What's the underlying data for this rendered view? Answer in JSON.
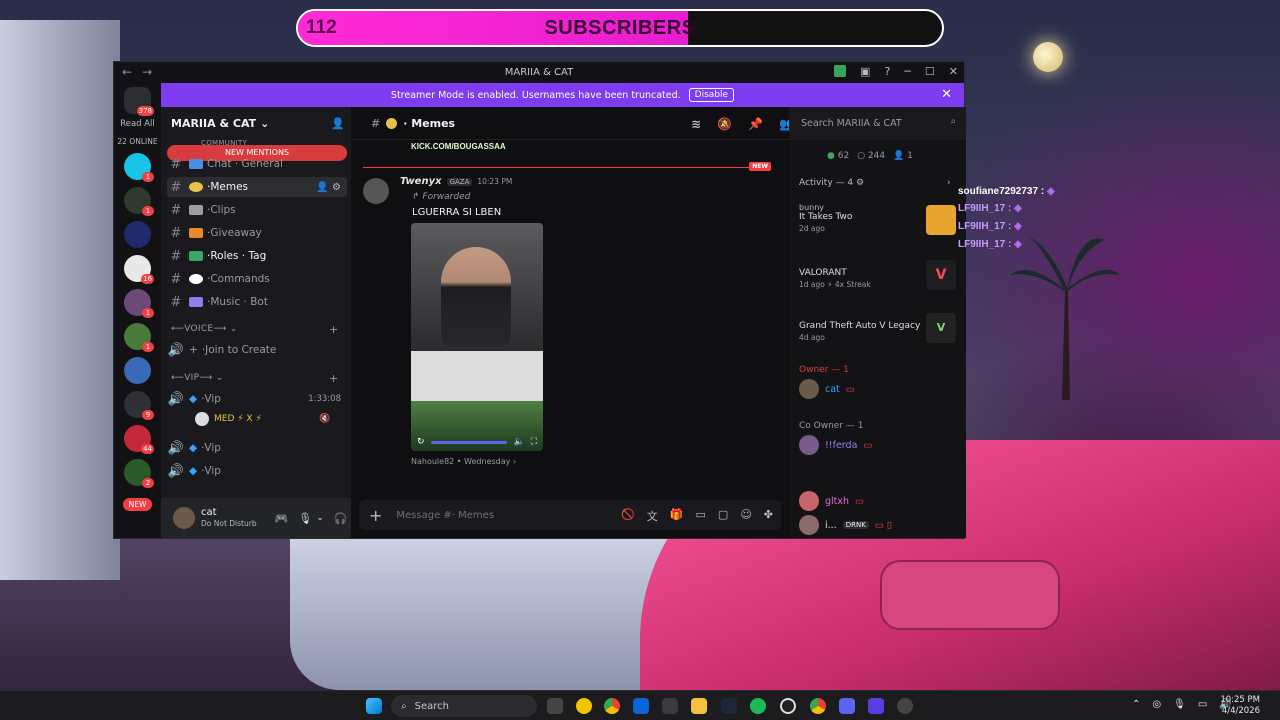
{
  "overlay": {
    "subscribers_count": "112",
    "subscribers_label": "SUBSCRIBERS",
    "progress": 0.605
  },
  "window": {
    "title": "MARIIA & CAT",
    "read_all": "Read All",
    "online": "22 ONLINE",
    "guild_badge": "378"
  },
  "banner": {
    "text": "Streamer Mode is enabled. Usernames have been truncated.",
    "button": "Disable"
  },
  "server": {
    "name": "MARIIA & CAT",
    "mentions": "NEW MENTIONS",
    "community": "COMMUNITY"
  },
  "channels": [
    {
      "name": "Chat · General",
      "emoji_color": "#4a90e2"
    },
    {
      "name": "Memes",
      "emoji_color": "#e8c14a"
    },
    {
      "name": "Clips",
      "emoji_color": "#9aa0a6"
    },
    {
      "name": "Giveaway",
      "emoji_color": "#e88a2a"
    },
    {
      "name": "Roles · Tag",
      "emoji_color": "#3ba55d"
    },
    {
      "name": "Commands",
      "emoji_color": "#ffffff"
    },
    {
      "name": "Music · Bot",
      "emoji_color": "#8e7cf0"
    }
  ],
  "voice": {
    "category": "VOICE",
    "join": "Join to Create",
    "vip_category": "VIP",
    "vip": "Vip",
    "vip_time": "1:33:08",
    "vip_user": "MED ⚡ X ⚡"
  },
  "user": {
    "name": "cat",
    "status": "Do Not Disturb"
  },
  "chat": {
    "channel": "· Memes",
    "kick_link": "KICK.COM/BOUGASSAA",
    "new_label": "NEW",
    "author": "Twenyx",
    "tag": "GAZA",
    "time": "10:23 PM",
    "forwarded": "Forwarded",
    "text": "LGUERRA SI LBEN",
    "source": "Nahoule82 • Wednesday",
    "placeholder": "Message #· Memes"
  },
  "search": {
    "placeholder": "Search MARIIA & CAT"
  },
  "members_panel": {
    "online": "62",
    "total": "244",
    "extra": "1",
    "activity_title": "Activity — 4",
    "activities": [
      {
        "user": "bunny",
        "game": "It Takes Two",
        "meta": "2d ago"
      },
      {
        "user": "",
        "game": "VALORANT",
        "meta": "1d ago  ⚡ 4x Streak"
      },
      {
        "user": "",
        "game": "Grand Theft Auto V Legacy",
        "meta": "4d ago"
      }
    ],
    "groups": [
      {
        "title": "Owner — 1",
        "members": [
          "cat"
        ]
      },
      {
        "title": "Co Owner — 1",
        "members": [
          "!!ferda"
        ]
      },
      {
        "title": "",
        "members": [
          "gltxh",
          "i..."
        ]
      }
    ],
    "drnk": "DRNK"
  },
  "stream_chat": [
    "soufiane7292737 :",
    "LF9IIH_17 :",
    "LF9IIH_17 :",
    "LF9IIH_17 :"
  ],
  "taskbar": {
    "search": "Search",
    "time": "10:25 PM",
    "date": "4/4/2026"
  }
}
